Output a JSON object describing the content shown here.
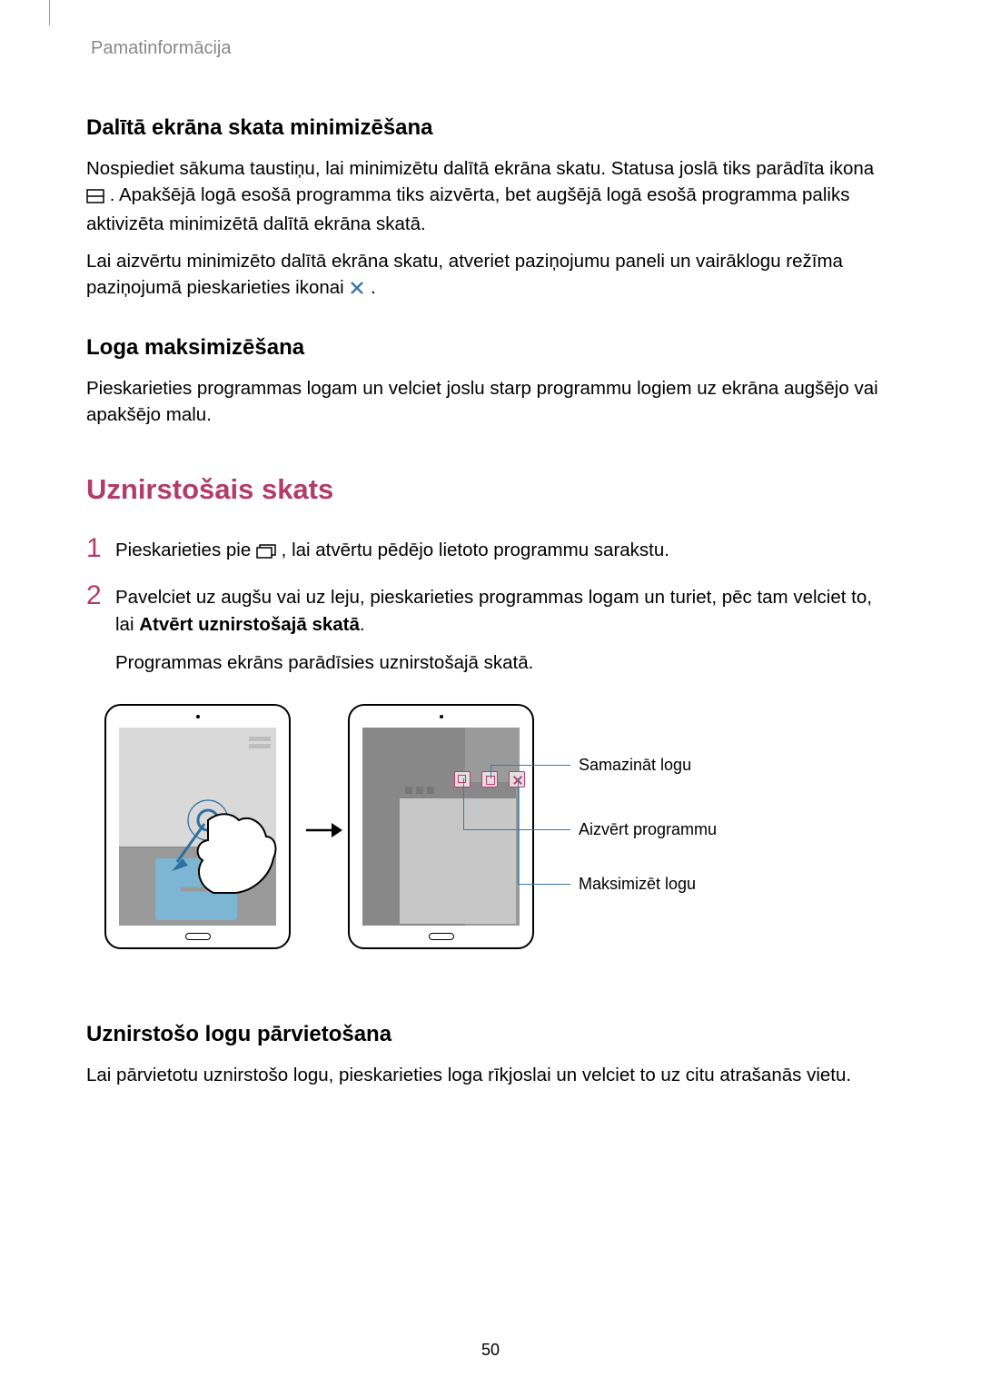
{
  "breadcrumb": "Pamatinformācija",
  "sec1": {
    "title": "Dalītā ekrāna skata minimizēšana",
    "p1a": "Nospiediet sākuma taustiņu, lai minimizētu dalītā ekrāna skatu. Statusa joslā tiks parādīta ikona ",
    "p1b": ". Apakšējā logā esošā programma tiks aizvērta, bet augšējā logā esošā programma paliks aktivizēta minimizētā dalītā ekrāna skatā.",
    "p2a": "Lai aizvērtu minimizēto dalītā ekrāna skatu, atveriet paziņojumu paneli un vairāklogu režīma paziņojumā pieskarieties ikonai ",
    "p2b": "."
  },
  "sec2": {
    "title": "Loga maksimizēšana",
    "p1": "Pieskarieties programmas logam un velciet joslu starp programmu logiem uz ekrāna augšējo vai apakšējo malu."
  },
  "sec3": {
    "title": "Uznirstošais skats",
    "step1a": "Pieskarieties pie ",
    "step1b": ", lai atvērtu pēdējo lietoto programmu sarakstu.",
    "step2a": "Pavelciet uz augšu vai uz leju, pieskarieties programmas logam un turiet, pēc tam velciet to, lai ",
    "step2bold": "Atvērt uznirstošajā skatā",
    "step2b": ".",
    "step2extra": "Programmas ekrāns parādīsies uznirstošajā skatā.",
    "callout1": "Samazināt logu",
    "callout2": "Aizvērt programmu",
    "callout3": "Maksimizēt logu"
  },
  "sec4": {
    "title": "Uznirstošo logu pārvietošana",
    "p1": "Lai pārvietotu uznirstošo logu, pieskarieties loga rīkjoslai un velciet to uz citu atrašanās vietu."
  },
  "pagenum": "50",
  "nums": {
    "one": "1",
    "two": "2"
  }
}
